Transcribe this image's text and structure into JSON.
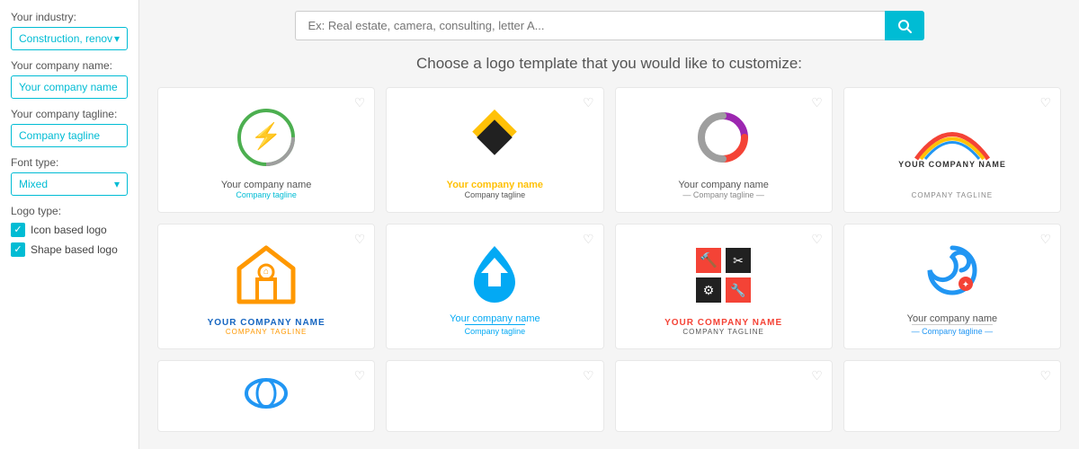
{
  "sidebar": {
    "industry_label": "Your industry:",
    "industry_value": "Construction, renov",
    "company_name_label": "Your company name:",
    "company_name_value": "Your company name",
    "tagline_label": "Your company tagline:",
    "tagline_value": "Company tagline",
    "font_label": "Font type:",
    "font_value": "Mixed",
    "logo_type_label": "Logo type:",
    "checkbox1_label": "Icon based logo",
    "checkbox2_label": "Shape based logo"
  },
  "search": {
    "placeholder": "Ex: Real estate, camera, consulting, letter A...",
    "button_icon": "🔍"
  },
  "page_title": "Choose a logo template that you would like to customize:",
  "logos": [
    {
      "id": 1,
      "name": "Your company name",
      "tagline": "Company tagline"
    },
    {
      "id": 2,
      "name": "Your company name",
      "tagline": "Company tagline"
    },
    {
      "id": 3,
      "name": "Your company name",
      "tagline": "Company tagline"
    },
    {
      "id": 4,
      "name": "YOUR COMPANY NAME",
      "tagline": "COMPANY TAGLINE"
    },
    {
      "id": 5,
      "name": "YOUR COMPANY NAME",
      "tagline": "COMPANY TAGLINE"
    },
    {
      "id": 6,
      "name": "Your company name",
      "tagline": "Company tagline"
    },
    {
      "id": 7,
      "name": "YOUR COMPANY NAME",
      "tagline": "COMPANY TAGLINE"
    },
    {
      "id": 8,
      "name": "Your company name",
      "tagline": "Company tagline"
    },
    {
      "id": 9,
      "name": "",
      "tagline": ""
    },
    {
      "id": 10,
      "name": "",
      "tagline": ""
    },
    {
      "id": 11,
      "name": "",
      "tagline": ""
    },
    {
      "id": 12,
      "name": "",
      "tagline": ""
    }
  ]
}
